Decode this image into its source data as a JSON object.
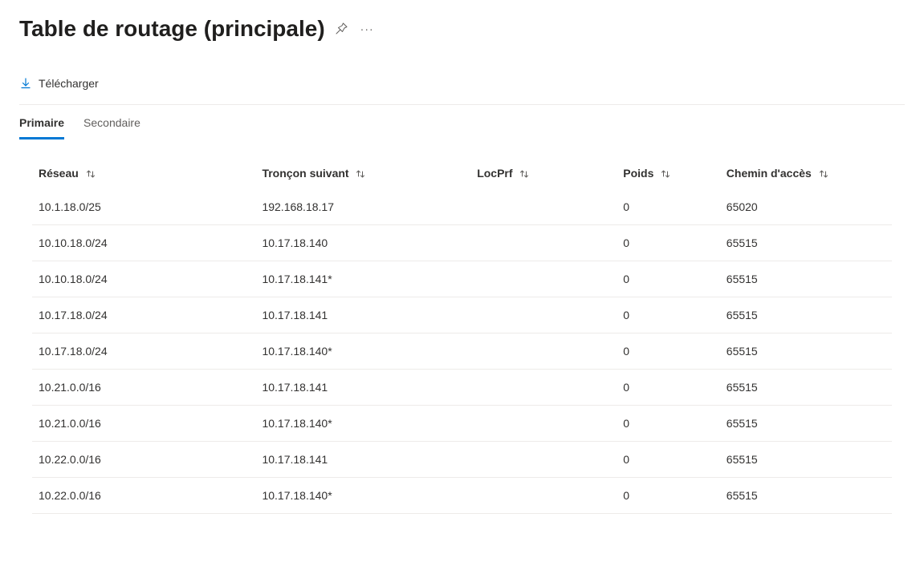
{
  "header": {
    "title": "Table de routage (principale)"
  },
  "toolbar": {
    "download_label": "Télécharger"
  },
  "tabs": [
    {
      "label": "Primaire",
      "active": true
    },
    {
      "label": "Secondaire",
      "active": false
    }
  ],
  "table": {
    "columns": [
      {
        "key": "network",
        "label": "Réseau"
      },
      {
        "key": "nexthop",
        "label": "Tronçon suivant"
      },
      {
        "key": "locprf",
        "label": "LocPrf"
      },
      {
        "key": "weight",
        "label": "Poids"
      },
      {
        "key": "path",
        "label": "Chemin d'accès"
      }
    ],
    "rows": [
      {
        "network": "10.1.18.0/25",
        "nexthop": "192.168.18.17",
        "locprf": "",
        "weight": "0",
        "path": "65020"
      },
      {
        "network": "10.10.18.0/24",
        "nexthop": "10.17.18.140",
        "locprf": "",
        "weight": "0",
        "path": "65515"
      },
      {
        "network": "10.10.18.0/24",
        "nexthop": "10.17.18.141*",
        "locprf": "",
        "weight": "0",
        "path": "65515"
      },
      {
        "network": "10.17.18.0/24",
        "nexthop": "10.17.18.141",
        "locprf": "",
        "weight": "0",
        "path": "65515"
      },
      {
        "network": "10.17.18.0/24",
        "nexthop": "10.17.18.140*",
        "locprf": "",
        "weight": "0",
        "path": "65515"
      },
      {
        "network": "10.21.0.0/16",
        "nexthop": "10.17.18.141",
        "locprf": "",
        "weight": "0",
        "path": "65515"
      },
      {
        "network": "10.21.0.0/16",
        "nexthop": "10.17.18.140*",
        "locprf": "",
        "weight": "0",
        "path": "65515"
      },
      {
        "network": "10.22.0.0/16",
        "nexthop": "10.17.18.141",
        "locprf": "",
        "weight": "0",
        "path": "65515"
      },
      {
        "network": "10.22.0.0/16",
        "nexthop": "10.17.18.140*",
        "locprf": "",
        "weight": "0",
        "path": "65515"
      }
    ]
  }
}
